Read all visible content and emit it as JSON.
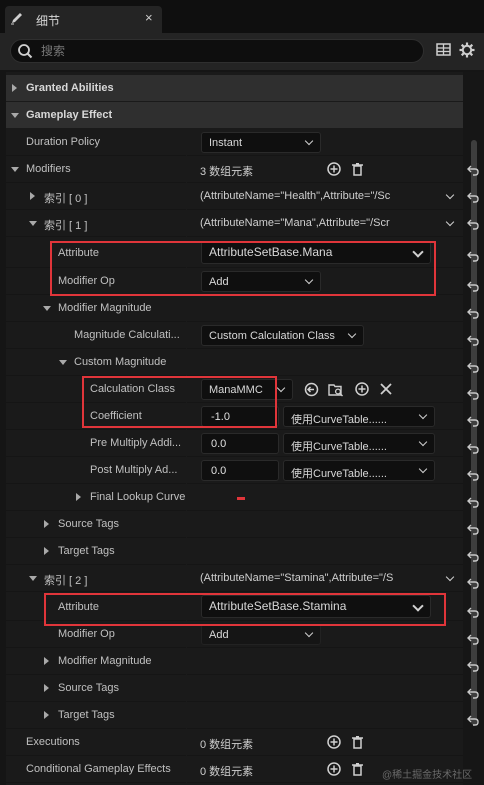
{
  "tab": {
    "title": "细节",
    "close": "×"
  },
  "search": {
    "placeholder": "搜索"
  },
  "categories": {
    "granted": "Granted Abilities",
    "effect": "Gameplay Effect"
  },
  "duration_policy": {
    "label": "Duration Policy",
    "value": "Instant"
  },
  "modifiers": {
    "label": "Modifiers",
    "count": "3 数组元素",
    "index0": {
      "label": "索引 [ 0 ]",
      "value": "(AttributeName=\"Health\",Attribute=\"/Sc"
    },
    "index1": {
      "label": "索引 [ 1 ]",
      "value": "(AttributeName=\"Mana\",Attribute=\"/Scr",
      "attribute": {
        "label": "Attribute",
        "value": "AttributeSetBase.Mana"
      },
      "modifier_op": {
        "label": "Modifier Op",
        "value": "Add"
      },
      "magnitude": {
        "label": "Modifier Magnitude",
        "calc_type": {
          "label": "Magnitude Calculati...",
          "value": "Custom Calculation Class"
        },
        "custom": {
          "label": "Custom Magnitude",
          "calc_class": {
            "label": "Calculation Class",
            "value": "ManaMMC"
          },
          "coefficient": {
            "label": "Coefficient",
            "value": "-1.0",
            "curve": "使用CurveTable......"
          },
          "pre_multiply": {
            "label": "Pre Multiply Addi...",
            "value": "0.0",
            "curve": "使用CurveTable......"
          },
          "post_multiply": {
            "label": "Post Multiply Ad...",
            "value": "0.0",
            "curve": "使用CurveTable......"
          },
          "final_lookup": {
            "label": "Final Lookup Curve"
          }
        }
      },
      "source_tags": "Source Tags",
      "target_tags": "Target Tags"
    },
    "index2": {
      "label": "索引 [ 2 ]",
      "value": "(AttributeName=\"Stamina\",Attribute=\"/S",
      "attribute": {
        "label": "Attribute",
        "value": "AttributeSetBase.Stamina"
      },
      "modifier_op": {
        "label": "Modifier Op",
        "value": "Add"
      },
      "magnitude": "Modifier Magnitude",
      "source_tags": "Source Tags",
      "target_tags": "Target Tags"
    }
  },
  "executions": {
    "label": "Executions",
    "count": "0 数组元素"
  },
  "conditional": {
    "label": "Conditional Gameplay Effects",
    "count": "0 数组元素"
  },
  "watermark": "@稀土掘金技术社区",
  "colors": {
    "highlight": "#e0353a",
    "panel": "#1a1a1a",
    "input_bg": "#0f0f0f"
  }
}
